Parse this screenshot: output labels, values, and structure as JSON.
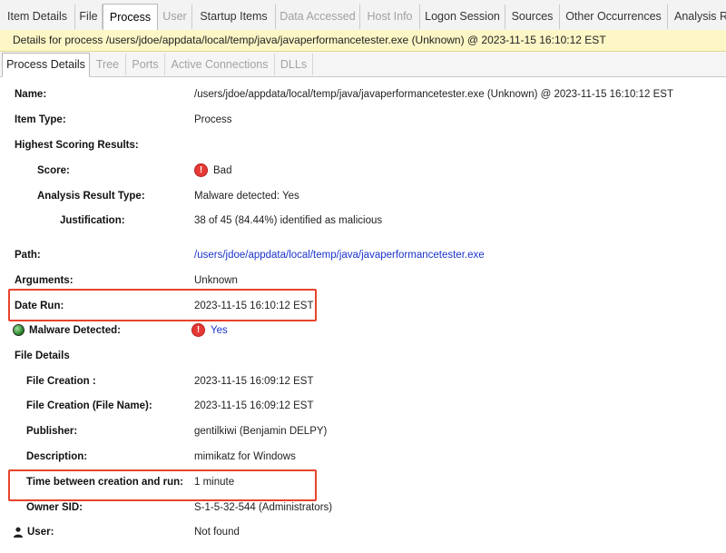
{
  "top_tabs": [
    {
      "label": "Item Details",
      "state": "normal"
    },
    {
      "label": "File",
      "state": "normal"
    },
    {
      "label": "Process",
      "state": "active"
    },
    {
      "label": "User",
      "state": "disabled"
    },
    {
      "label": "Startup Items",
      "state": "normal"
    },
    {
      "label": "Data Accessed",
      "state": "disabled"
    },
    {
      "label": "Host Info",
      "state": "disabled"
    },
    {
      "label": "Logon Session",
      "state": "normal"
    },
    {
      "label": "Sources",
      "state": "normal"
    },
    {
      "label": "Other Occurrences",
      "state": "normal"
    },
    {
      "label": "Analysis Re",
      "state": "normal"
    }
  ],
  "info_bar": "Details for process /users/jdoe/appdata/local/temp/java/javaperformancetester.exe (Unknown) @ 2023-11-15 16:10:12 EST",
  "sub_tabs": [
    {
      "label": "Process Details",
      "state": "active"
    },
    {
      "label": "Tree",
      "state": "disabled"
    },
    {
      "label": "Ports",
      "state": "disabled"
    },
    {
      "label": "Active Connections",
      "state": "disabled"
    },
    {
      "label": "DLLs",
      "state": "disabled"
    }
  ],
  "details": {
    "name_label": "Name:",
    "name_value": "/users/jdoe/appdata/local/temp/java/javaperformancetester.exe (Unknown) @ 2023-11-15 16:10:12 EST",
    "item_type_label": "Item Type:",
    "item_type_value": "Process",
    "highest_scoring_label": "Highest Scoring Results:",
    "score_label": "Score:",
    "score_value": "Bad",
    "analysis_type_label": "Analysis Result Type:",
    "analysis_type_value": "Malware detected: Yes",
    "justification_label": "Justification:",
    "justification_value": "38 of 45 (84.44%) identified as malicious",
    "path_label": "Path:",
    "path_value": "/users/jdoe/appdata/local/temp/java/javaperformancetester.exe",
    "arguments_label": "Arguments:",
    "arguments_value": "Unknown",
    "date_run_label": "Date Run:",
    "date_run_value": "2023-11-15 16:10:12 EST",
    "malware_label": "Malware Detected:",
    "malware_value": "Yes",
    "file_details_label": "File Details",
    "file_creation_label": "File Creation :",
    "file_creation_value": "2023-11-15 16:09:12 EST",
    "file_creation_name_label": "File Creation (File Name):",
    "file_creation_name_value": "2023-11-15 16:09:12 EST",
    "publisher_label": "Publisher:",
    "publisher_value": "gentilkiwi (Benjamin DELPY)",
    "description_label": "Description:",
    "description_value": "mimikatz for Windows",
    "time_between_label": "Time between creation and run:",
    "time_between_value": "1 minute",
    "owner_sid_label": "Owner SID:",
    "owner_sid_value": "S-1-5-32-544 (Administrators)",
    "user_label": "User:",
    "user_value": "Not found"
  },
  "colors": {
    "info_bar_bg": "#fdf6c6",
    "link": "#1a33cc",
    "bad_icon": "#e53935",
    "highlight_box": "#e8432b"
  },
  "icons": {
    "score": "alert-circle-icon",
    "malware_status": "green-status-dot-icon",
    "malware_value": "alert-circle-icon",
    "user": "person-icon"
  }
}
